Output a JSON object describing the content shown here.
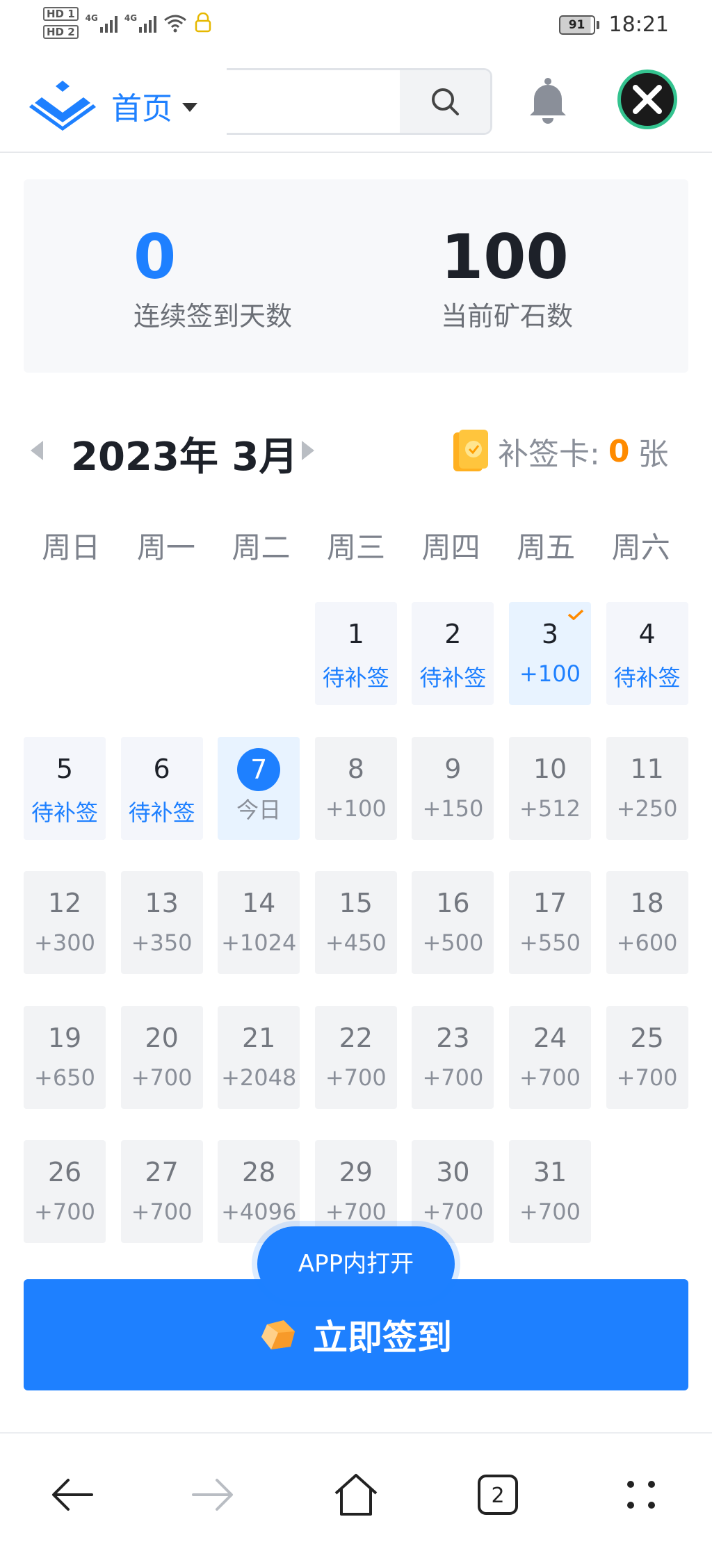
{
  "status_bar": {
    "hd1": "HD 1",
    "hd2": "HD 2",
    "net1": "4G",
    "net2": "4G",
    "battery": "91",
    "time": "18:21"
  },
  "header": {
    "home_label": "首页",
    "search_placeholder": ""
  },
  "stats": {
    "streak_value": "0",
    "streak_label": "连续签到天数",
    "ore_value": "100",
    "ore_label": "当前矿石数"
  },
  "calendar": {
    "month_title": "2023年 3月",
    "makeup_card_label": "补签卡:",
    "makeup_card_count": "0",
    "makeup_card_unit": "张",
    "weekdays": [
      "周日",
      "周一",
      "周二",
      "周三",
      "周四",
      "周五",
      "周六"
    ],
    "days": [
      {
        "day": "1",
        "reward": "待补签",
        "state": "pending"
      },
      {
        "day": "2",
        "reward": "待补签",
        "state": "pending"
      },
      {
        "day": "3",
        "reward": "+100",
        "state": "signed"
      },
      {
        "day": "4",
        "reward": "待补签",
        "state": "pending"
      },
      {
        "day": "5",
        "reward": "待补签",
        "state": "pending"
      },
      {
        "day": "6",
        "reward": "待补签",
        "state": "pending"
      },
      {
        "day": "7",
        "reward": "今日",
        "state": "today"
      },
      {
        "day": "8",
        "reward": "+100",
        "state": "future"
      },
      {
        "day": "9",
        "reward": "+150",
        "state": "future"
      },
      {
        "day": "10",
        "reward": "+512",
        "state": "future"
      },
      {
        "day": "11",
        "reward": "+250",
        "state": "future"
      },
      {
        "day": "12",
        "reward": "+300",
        "state": "future"
      },
      {
        "day": "13",
        "reward": "+350",
        "state": "future"
      },
      {
        "day": "14",
        "reward": "+1024",
        "state": "future"
      },
      {
        "day": "15",
        "reward": "+450",
        "state": "future"
      },
      {
        "day": "16",
        "reward": "+500",
        "state": "future"
      },
      {
        "day": "17",
        "reward": "+550",
        "state": "future"
      },
      {
        "day": "18",
        "reward": "+600",
        "state": "future"
      },
      {
        "day": "19",
        "reward": "+650",
        "state": "future"
      },
      {
        "day": "20",
        "reward": "+700",
        "state": "future"
      },
      {
        "day": "21",
        "reward": "+2048",
        "state": "future"
      },
      {
        "day": "22",
        "reward": "+700",
        "state": "future"
      },
      {
        "day": "23",
        "reward": "+700",
        "state": "future"
      },
      {
        "day": "24",
        "reward": "+700",
        "state": "future"
      },
      {
        "day": "25",
        "reward": "+700",
        "state": "future"
      },
      {
        "day": "26",
        "reward": "+700",
        "state": "future"
      },
      {
        "day": "27",
        "reward": "+700",
        "state": "future"
      },
      {
        "day": "28",
        "reward": "+4096",
        "state": "future"
      },
      {
        "day": "29",
        "reward": "+700",
        "state": "future"
      },
      {
        "day": "30",
        "reward": "+700",
        "state": "future"
      },
      {
        "day": "31",
        "reward": "+700",
        "state": "future"
      }
    ]
  },
  "actions": {
    "open_in_app": "APP内打开",
    "sign_in": "立即签到"
  },
  "browser_nav": {
    "tab_count": "2"
  },
  "colors": {
    "accent": "#1e80ff",
    "card_count": "#ff8b00"
  }
}
